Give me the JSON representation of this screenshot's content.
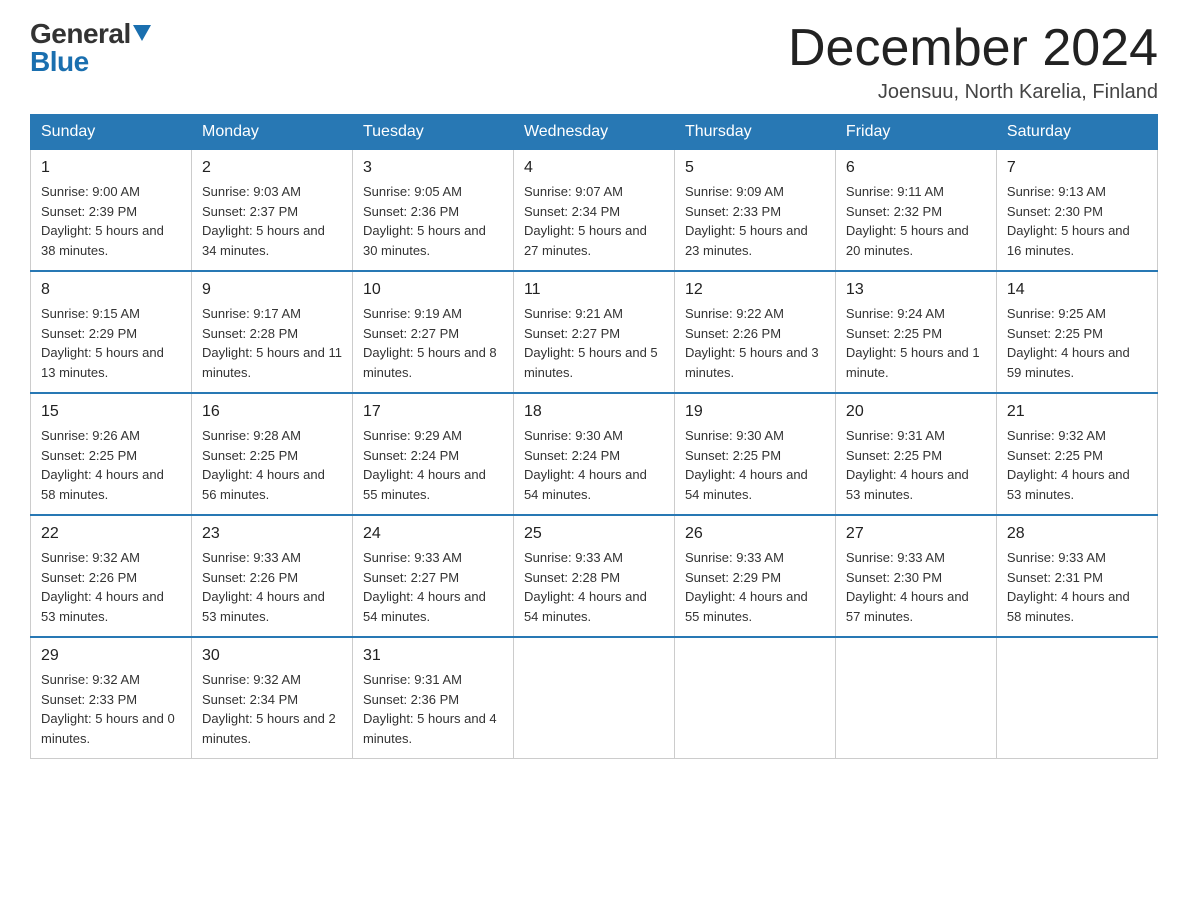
{
  "logo": {
    "general": "General",
    "blue": "Blue"
  },
  "title": "December 2024",
  "location": "Joensuu, North Karelia, Finland",
  "days_of_week": [
    "Sunday",
    "Monday",
    "Tuesday",
    "Wednesday",
    "Thursday",
    "Friday",
    "Saturday"
  ],
  "weeks": [
    [
      {
        "day": "1",
        "sunrise": "9:00 AM",
        "sunset": "2:39 PM",
        "daylight": "5 hours and 38 minutes."
      },
      {
        "day": "2",
        "sunrise": "9:03 AM",
        "sunset": "2:37 PM",
        "daylight": "5 hours and 34 minutes."
      },
      {
        "day": "3",
        "sunrise": "9:05 AM",
        "sunset": "2:36 PM",
        "daylight": "5 hours and 30 minutes."
      },
      {
        "day": "4",
        "sunrise": "9:07 AM",
        "sunset": "2:34 PM",
        "daylight": "5 hours and 27 minutes."
      },
      {
        "day": "5",
        "sunrise": "9:09 AM",
        "sunset": "2:33 PM",
        "daylight": "5 hours and 23 minutes."
      },
      {
        "day": "6",
        "sunrise": "9:11 AM",
        "sunset": "2:32 PM",
        "daylight": "5 hours and 20 minutes."
      },
      {
        "day": "7",
        "sunrise": "9:13 AM",
        "sunset": "2:30 PM",
        "daylight": "5 hours and 16 minutes."
      }
    ],
    [
      {
        "day": "8",
        "sunrise": "9:15 AM",
        "sunset": "2:29 PM",
        "daylight": "5 hours and 13 minutes."
      },
      {
        "day": "9",
        "sunrise": "9:17 AM",
        "sunset": "2:28 PM",
        "daylight": "5 hours and 11 minutes."
      },
      {
        "day": "10",
        "sunrise": "9:19 AM",
        "sunset": "2:27 PM",
        "daylight": "5 hours and 8 minutes."
      },
      {
        "day": "11",
        "sunrise": "9:21 AM",
        "sunset": "2:27 PM",
        "daylight": "5 hours and 5 minutes."
      },
      {
        "day": "12",
        "sunrise": "9:22 AM",
        "sunset": "2:26 PM",
        "daylight": "5 hours and 3 minutes."
      },
      {
        "day": "13",
        "sunrise": "9:24 AM",
        "sunset": "2:25 PM",
        "daylight": "5 hours and 1 minute."
      },
      {
        "day": "14",
        "sunrise": "9:25 AM",
        "sunset": "2:25 PM",
        "daylight": "4 hours and 59 minutes."
      }
    ],
    [
      {
        "day": "15",
        "sunrise": "9:26 AM",
        "sunset": "2:25 PM",
        "daylight": "4 hours and 58 minutes."
      },
      {
        "day": "16",
        "sunrise": "9:28 AM",
        "sunset": "2:25 PM",
        "daylight": "4 hours and 56 minutes."
      },
      {
        "day": "17",
        "sunrise": "9:29 AM",
        "sunset": "2:24 PM",
        "daylight": "4 hours and 55 minutes."
      },
      {
        "day": "18",
        "sunrise": "9:30 AM",
        "sunset": "2:24 PM",
        "daylight": "4 hours and 54 minutes."
      },
      {
        "day": "19",
        "sunrise": "9:30 AM",
        "sunset": "2:25 PM",
        "daylight": "4 hours and 54 minutes."
      },
      {
        "day": "20",
        "sunrise": "9:31 AM",
        "sunset": "2:25 PM",
        "daylight": "4 hours and 53 minutes."
      },
      {
        "day": "21",
        "sunrise": "9:32 AM",
        "sunset": "2:25 PM",
        "daylight": "4 hours and 53 minutes."
      }
    ],
    [
      {
        "day": "22",
        "sunrise": "9:32 AM",
        "sunset": "2:26 PM",
        "daylight": "4 hours and 53 minutes."
      },
      {
        "day": "23",
        "sunrise": "9:33 AM",
        "sunset": "2:26 PM",
        "daylight": "4 hours and 53 minutes."
      },
      {
        "day": "24",
        "sunrise": "9:33 AM",
        "sunset": "2:27 PM",
        "daylight": "4 hours and 54 minutes."
      },
      {
        "day": "25",
        "sunrise": "9:33 AM",
        "sunset": "2:28 PM",
        "daylight": "4 hours and 54 minutes."
      },
      {
        "day": "26",
        "sunrise": "9:33 AM",
        "sunset": "2:29 PM",
        "daylight": "4 hours and 55 minutes."
      },
      {
        "day": "27",
        "sunrise": "9:33 AM",
        "sunset": "2:30 PM",
        "daylight": "4 hours and 57 minutes."
      },
      {
        "day": "28",
        "sunrise": "9:33 AM",
        "sunset": "2:31 PM",
        "daylight": "4 hours and 58 minutes."
      }
    ],
    [
      {
        "day": "29",
        "sunrise": "9:32 AM",
        "sunset": "2:33 PM",
        "daylight": "5 hours and 0 minutes."
      },
      {
        "day": "30",
        "sunrise": "9:32 AM",
        "sunset": "2:34 PM",
        "daylight": "5 hours and 2 minutes."
      },
      {
        "day": "31",
        "sunrise": "9:31 AM",
        "sunset": "2:36 PM",
        "daylight": "5 hours and 4 minutes."
      },
      null,
      null,
      null,
      null
    ]
  ]
}
